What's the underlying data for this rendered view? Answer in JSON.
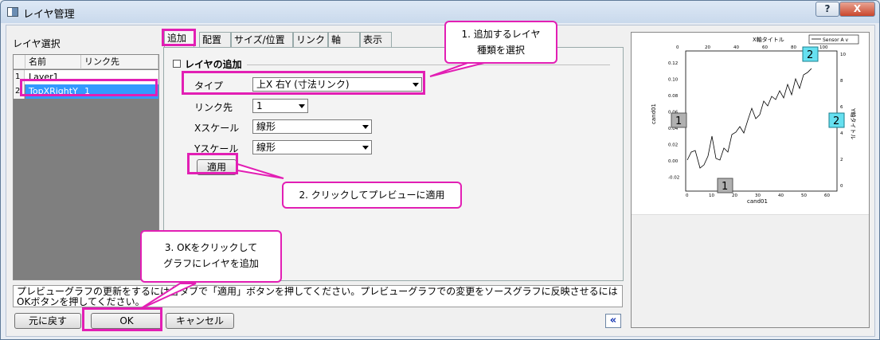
{
  "window": {
    "title": "レイヤ管理",
    "help_label": "?",
    "close_label": "X"
  },
  "layer_select": {
    "label": "レイヤ選択",
    "columns": [
      "名前",
      "リンク先"
    ],
    "rows": [
      {
        "num": "1",
        "name": "Layer1",
        "link": ""
      },
      {
        "num": "2",
        "name": "TopXRightY",
        "link": "1"
      }
    ]
  },
  "tabs": [
    "追加",
    "配置",
    "サイズ/位置",
    "リンク",
    "軸",
    "表示"
  ],
  "add_group": {
    "title": "レイヤの追加",
    "type_label": "タイプ",
    "type_value": "上X 右Y (寸法リンク)",
    "link_label": "リンク先",
    "link_value": "1",
    "xscale_label": "Xスケール",
    "xscale_value": "線形",
    "yscale_label": "Yスケール",
    "yscale_value": "線形",
    "apply_label": "適用"
  },
  "status_text": "プレビューグラフの更新をするには各タブで「適用」ボタンを押してください。プレビューグラフでの変更をソースグラフに反映させるにはOKボタンを押してください。",
  "buttons": {
    "undo": "元に戻す",
    "ok": "OK",
    "cancel": "キャンセル",
    "collapse": "«"
  },
  "callouts": {
    "c1_line1": "1. 追加するレイヤ",
    "c1_line2": "種類を選択",
    "c2": "2. クリックしてプレビューに適用",
    "c3_line1": "3. OKをクリックして",
    "c3_line2": "グラフにレイヤを追加"
  },
  "preview": {
    "top_axis_title": "X軸タイトル",
    "bottom_axis_title": "cand01",
    "left_axis_title": "cand01",
    "right_axis_title": "Y軸タイトル",
    "legend": "Sensor A v",
    "layer1_label": "1",
    "layer2_label": "2",
    "left_ticks": [
      "0.12",
      "0.10",
      "0.08",
      "0.06",
      "0.04",
      "0.02",
      "0.00",
      "-0.02"
    ],
    "right_ticks": [
      "10",
      "8",
      "6",
      "4",
      "2",
      "0"
    ],
    "top_ticks": [
      "0",
      "20",
      "40",
      "60",
      "80",
      "100"
    ],
    "bottom_ticks": [
      "0",
      "10",
      "20",
      "30",
      "40",
      "50",
      "60"
    ]
  },
  "colors": {
    "highlight": "#e21fb4",
    "selection": "#3399ff",
    "layer2_badge": "#66e0f0",
    "layer1_badge": "#b0b0b0"
  }
}
